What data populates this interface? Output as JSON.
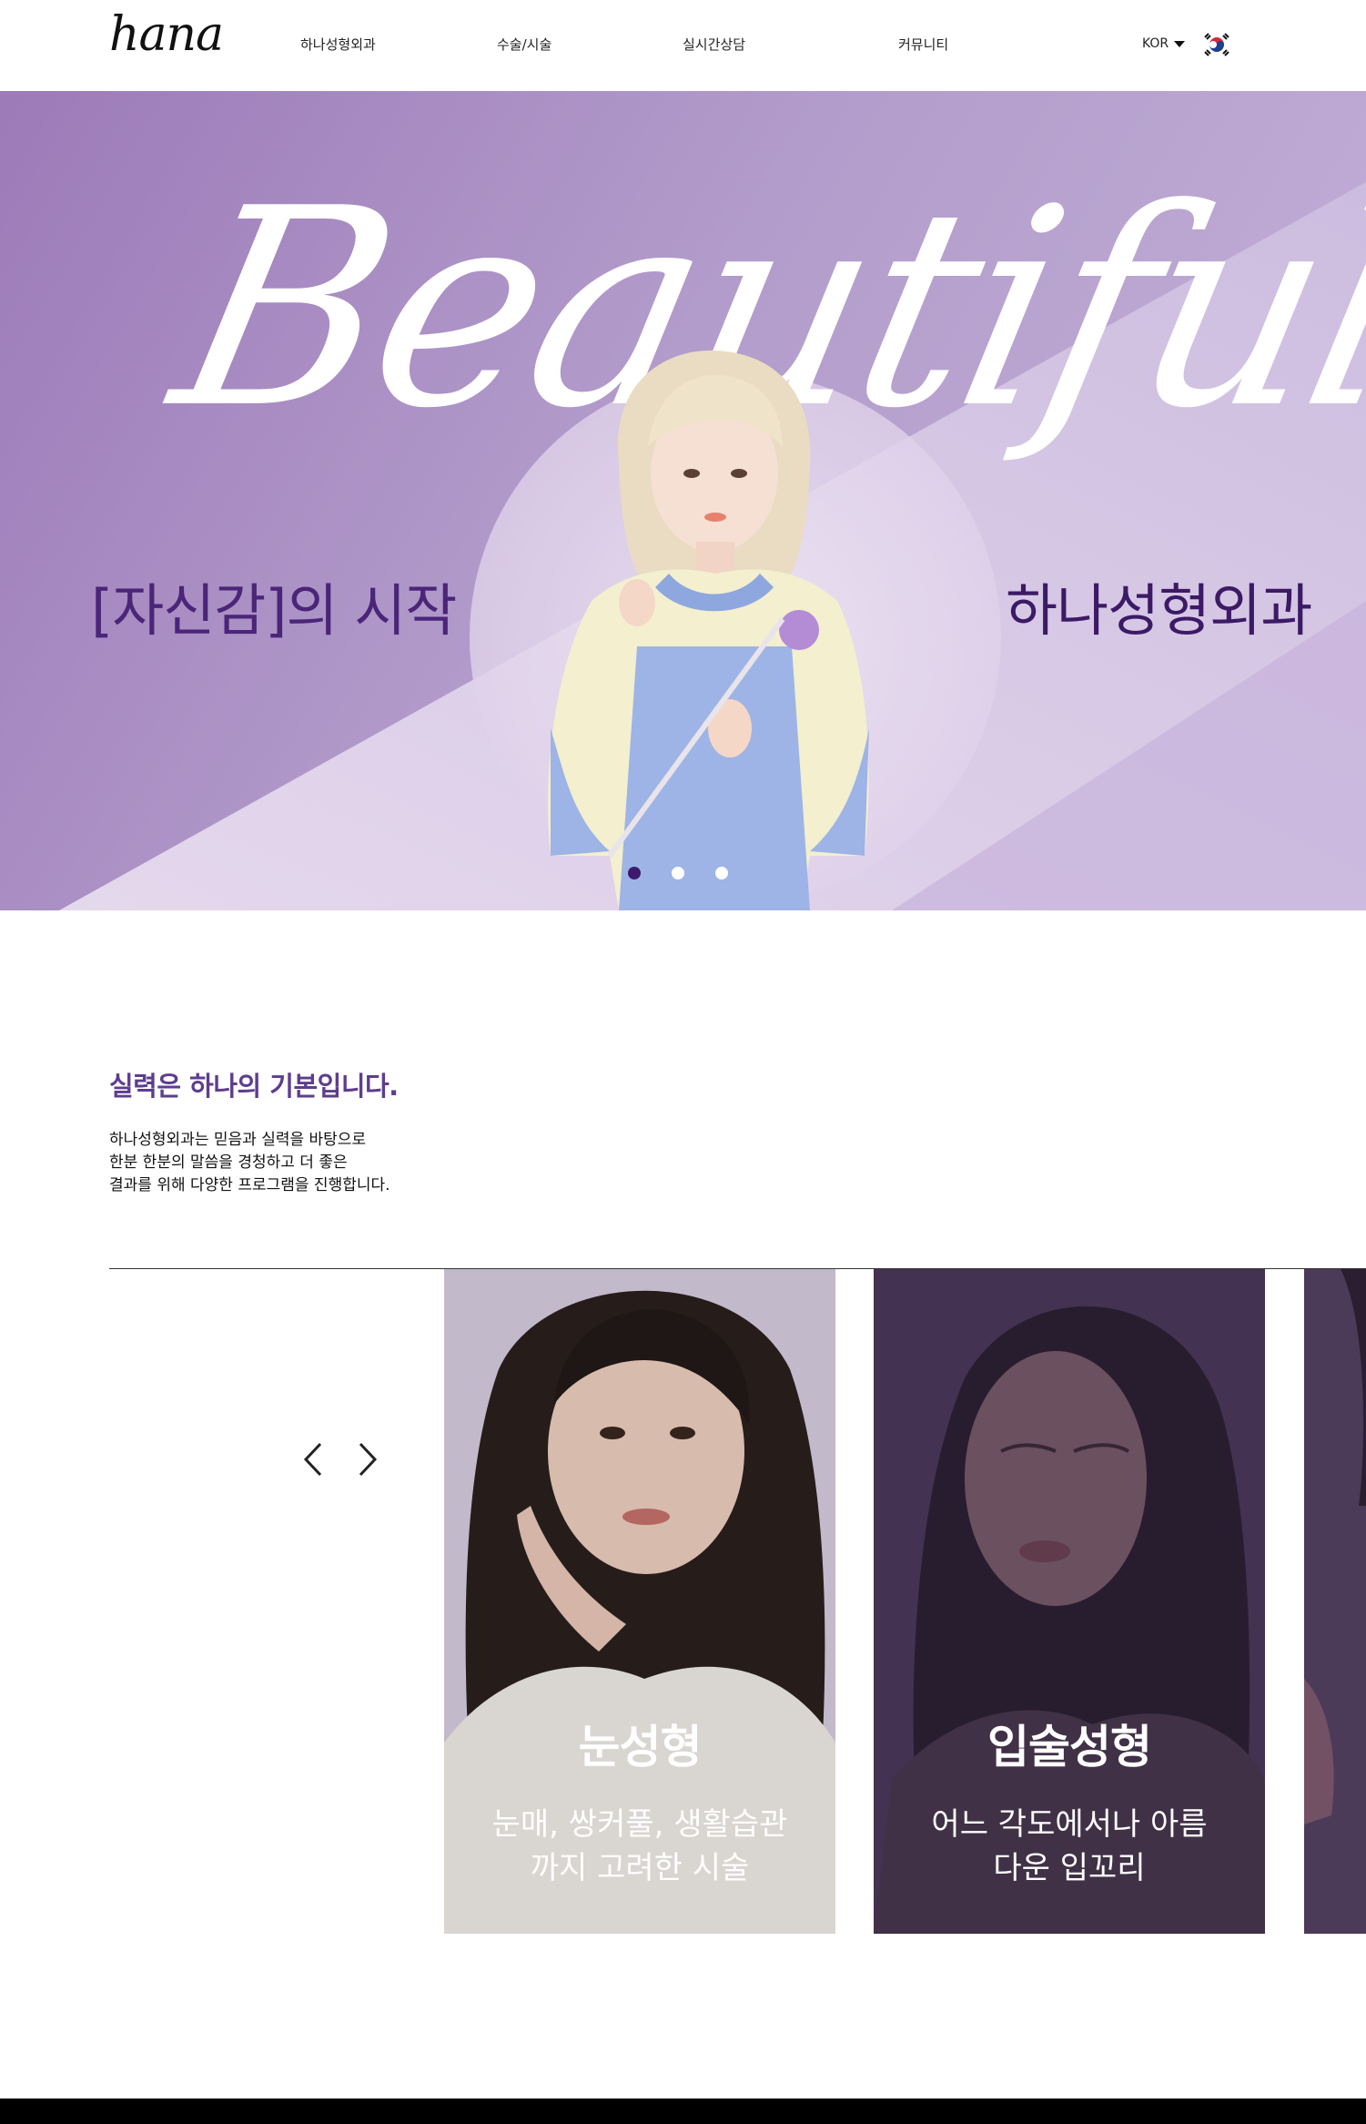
{
  "header": {
    "logo": "hana",
    "nav": [
      "하나성형외과",
      "수술/시술",
      "실시간상담",
      "커뮤니티"
    ],
    "language": "KOR",
    "flag_icon": "korea-flag-icon"
  },
  "hero": {
    "script_word": "Beautiful",
    "left_text": "[자신감]의 시작",
    "right_text": "하나성형외과",
    "slide_count": 3,
    "active_slide": 1,
    "colors": {
      "accent": "#4a2578",
      "background": "#b29ccb"
    }
  },
  "intro": {
    "title": "실력은 하나의 기본입니다.",
    "lines": [
      "하나성형외과는 믿음과 실력을 바탕으로",
      "한분 한분의 말씀을 경청하고 더 좋은",
      "결과를 위해 다양한 프로그램을 진행합니다."
    ]
  },
  "slider": {
    "prev_icon": "chevron-left-icon",
    "next_icon": "chevron-right-icon",
    "cards": [
      {
        "title": "눈성형",
        "desc": [
          "눈매, 쌍커풀, 생활습관",
          "까지 고려한 시술"
        ]
      },
      {
        "title": "입술성형",
        "desc": [
          "어느 각도에서나 아름",
          "다운 입꼬리"
        ]
      }
    ]
  }
}
